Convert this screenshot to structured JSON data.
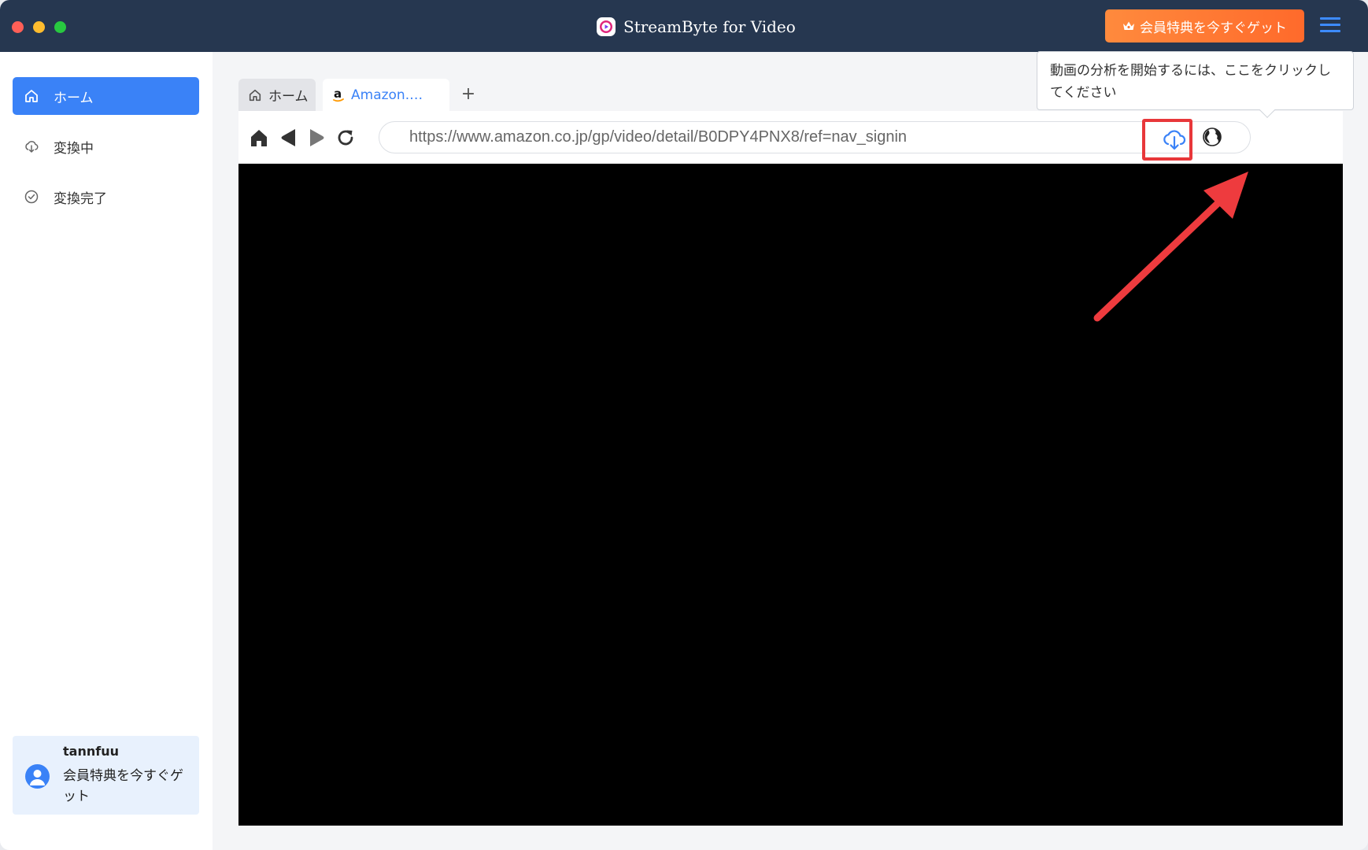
{
  "window": {
    "title": "StreamByte for Video",
    "promo_button": "会員特典を今すぐゲット"
  },
  "sidebar": {
    "items": [
      {
        "label": "ホーム",
        "icon": "home-icon",
        "active": true
      },
      {
        "label": "変換中",
        "icon": "cloud-download-icon",
        "active": false
      },
      {
        "label": "変換完了",
        "icon": "check-circle-icon",
        "active": false
      }
    ],
    "user": {
      "name": "tannfuu",
      "promo": "会員特典を今すぐゲット"
    }
  },
  "browser": {
    "tabs": [
      {
        "label": "ホーム",
        "icon": "home-icon"
      },
      {
        "label": "Amazon.…",
        "icon": "amazon-icon",
        "active": true
      }
    ],
    "add_tab": "+",
    "url": "https://www.amazon.co.jp/gp/video/detail/B0DPY4PNX8/ref=nav_signin"
  },
  "tooltip": {
    "text": "動画の分析を開始するには、ここをクリックしてください"
  },
  "colors": {
    "titlebar": "#263750",
    "accent": "#3a82f7",
    "promo": "#ff7a33",
    "highlight": "#e8373a"
  }
}
